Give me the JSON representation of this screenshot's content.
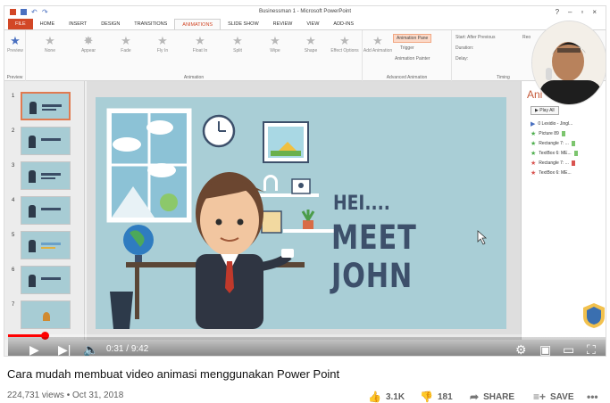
{
  "ppt": {
    "window_title": "Businessman 1 - Microsoft PowerPoint",
    "tabs": [
      "FILE",
      "HOME",
      "INSERT",
      "DESIGN",
      "TRANSITIONS",
      "ANIMATIONS",
      "SLIDE SHOW",
      "REVIEW",
      "VIEW",
      "ADD-INS"
    ],
    "active_tab": "ANIMATIONS",
    "preview_label": "Preview",
    "preview_group": "Preview",
    "animations": [
      "None",
      "Appear",
      "Fade",
      "Fly In",
      "Float In",
      "Split",
      "Wipe",
      "Shape"
    ],
    "animation_group": "Animation",
    "effect_options": "Effect Options",
    "add_animation": "Add Animation",
    "animation_pane_btn": "Animation Pane",
    "trigger_label": "Trigger",
    "animation_painter": "Animation Painter",
    "advanced_group": "Advanced Animation",
    "start_label": "Start: After Previous",
    "duration_label": "Duration:",
    "delay_label": "Delay:",
    "timing_group": "Timing",
    "reorder_label": "Reo"
  },
  "slides": {
    "numbers": [
      "1",
      "2",
      "3",
      "4",
      "5",
      "6",
      "7"
    ]
  },
  "slide": {
    "hei": "HEI....",
    "meet": "MEET JOHN"
  },
  "pane": {
    "title": "Ani",
    "play_all": "Play All",
    "items": [
      "0  Lexidio - Jingl...",
      "Picture 89",
      "Rectangle 7: ...",
      "TextBox 6: ME...",
      "Rectangle 7: ...",
      "TextBox 6: ME..."
    ]
  },
  "player": {
    "current": "0:31",
    "duration": "9:42",
    "progress_fraction": 0.06
  },
  "video": {
    "title": "Cara mudah membuat video animasi menggunakan Power Point",
    "views": "224,731 views",
    "date": "Oct 31, 2018",
    "likes": "3.1K",
    "dislikes": "181",
    "share": "SHARE",
    "save": "SAVE"
  },
  "colors": {
    "slide_bg": "#a9ced6",
    "title_text": "#3d506b",
    "progress": "#ff0000",
    "ppt_accent": "#d24726"
  }
}
